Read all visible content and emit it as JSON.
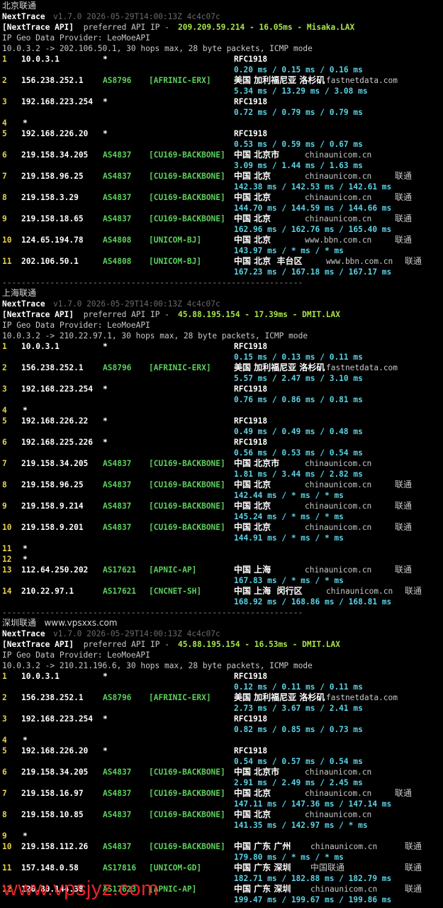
{
  "blocks": [
    {
      "title": "北京联通",
      "app": "NextTrace",
      "version": "v1.7.0 2026-05-29T14:00:13Z 4c4c07c",
      "api_prefix": "[NextTrace API]",
      "api_mid": " preferred API IP - ",
      "api_info": "209.209.59.214 - 16.05ms - Misaka.LAX",
      "geo_provider": "IP Geo Data Provider: LeoMoeAPI",
      "route": "10.0.3.2 -> 202.106.50.1, 30 hops max, 28 byte packets, ICMP mode",
      "hops": [
        {
          "n": "1",
          "ip": "10.0.3.1",
          "asn": "*",
          "tag": "",
          "geo": "RFC1918",
          "host": "",
          "isp": "",
          "lat": "0.20 ms / 0.15 ms / 0.16 ms"
        },
        {
          "n": "2",
          "ip": "156.238.252.1",
          "asn": "AS8796",
          "tag": "[AFRINIC-ERX]",
          "geo": "美国 加利福尼亚 洛杉矶",
          "host": "fastnetdata.com",
          "isp": "",
          "lat": "5.34 ms / 13.29 ms / 3.08 ms"
        },
        {
          "n": "3",
          "ip": "192.168.223.254",
          "asn": "*",
          "tag": "",
          "geo": "RFC1918",
          "host": "",
          "isp": "",
          "lat": "0.72 ms / 0.79 ms / 0.79 ms"
        },
        {
          "n": "4",
          "ip": "*",
          "asn": "",
          "tag": "",
          "geo": "",
          "host": "",
          "isp": "",
          "lat": ""
        },
        {
          "n": "5",
          "ip": "192.168.226.20",
          "asn": "*",
          "tag": "",
          "geo": "RFC1918",
          "host": "",
          "isp": "",
          "lat": "0.53 ms / 0.59 ms / 0.67 ms"
        },
        {
          "n": "6",
          "ip": "219.158.34.205",
          "asn": "AS4837",
          "tag": "[CU169-BACKBONE]",
          "geo": "中国 北京市",
          "host": "chinaunicom.cn",
          "isp": "",
          "lat": "3.09 ms / 1.44 ms / 1.63 ms"
        },
        {
          "n": "7",
          "ip": "219.158.96.25",
          "asn": "AS4837",
          "tag": "[CU169-BACKBONE]",
          "geo": "中国 北京",
          "host": "chinaunicom.cn",
          "isp": "联通",
          "lat": "142.38 ms / 142.53 ms / 142.61 ms"
        },
        {
          "n": "8",
          "ip": "219.158.3.29",
          "asn": "AS4837",
          "tag": "[CU169-BACKBONE]",
          "geo": "中国 北京",
          "host": "chinaunicom.cn",
          "isp": "联通",
          "lat": "144.70 ms / 144.59 ms / 144.66 ms"
        },
        {
          "n": "9",
          "ip": "219.158.18.65",
          "asn": "AS4837",
          "tag": "[CU169-BACKBONE]",
          "geo": "中国 北京",
          "host": "chinaunicom.cn",
          "isp": "联通",
          "lat": "162.96 ms / 162.76 ms / 165.40 ms"
        },
        {
          "n": "10",
          "ip": "124.65.194.78",
          "asn": "AS4808",
          "tag": "[UNICOM-BJ]",
          "geo": "中国 北京",
          "host": "www.bbn.com.cn",
          "isp": "联通",
          "lat": "143.97 ms / * ms / * ms"
        },
        {
          "n": "11",
          "ip": "202.106.50.1",
          "asn": "AS4808",
          "tag": "[UNICOM-BJ]",
          "geo": "中国 北京  丰台区",
          "host": "www.bbn.com.cn",
          "isp": "联通",
          "lat": "167.23 ms / 167.18 ms / 167.17 ms"
        }
      ],
      "separator": "---------------------------------------------------------------"
    },
    {
      "title": "上海联通",
      "app": "NextTrace",
      "version": "v1.7.0 2026-05-29T14:00:13Z 4c4c07c",
      "api_prefix": "[NextTrace API]",
      "api_mid": " preferred API IP - ",
      "api_info": "45.88.195.154 - 17.39ms - DMIT.LAX",
      "geo_provider": "IP Geo Data Provider: LeoMoeAPI",
      "route": "10.0.3.2 -> 210.22.97.1, 30 hops max, 28 byte packets, ICMP mode",
      "hops": [
        {
          "n": "1",
          "ip": "10.0.3.1",
          "asn": "*",
          "tag": "",
          "geo": "RFC1918",
          "host": "",
          "isp": "",
          "lat": "0.15 ms / 0.13 ms / 0.11 ms"
        },
        {
          "n": "2",
          "ip": "156.238.252.1",
          "asn": "AS8796",
          "tag": "[AFRINIC-ERX]",
          "geo": "美国 加利福尼亚 洛杉矶",
          "host": "fastnetdata.com",
          "isp": "",
          "lat": "5.57 ms / 2.47 ms / 3.10 ms"
        },
        {
          "n": "3",
          "ip": "192.168.223.254",
          "asn": "*",
          "tag": "",
          "geo": "RFC1918",
          "host": "",
          "isp": "",
          "lat": "0.76 ms / 0.86 ms / 0.81 ms"
        },
        {
          "n": "4",
          "ip": "*",
          "asn": "",
          "tag": "",
          "geo": "",
          "host": "",
          "isp": "",
          "lat": ""
        },
        {
          "n": "5",
          "ip": "192.168.226.22",
          "asn": "*",
          "tag": "",
          "geo": "RFC1918",
          "host": "",
          "isp": "",
          "lat": "0.49 ms / 0.49 ms / 0.48 ms"
        },
        {
          "n": "6",
          "ip": "192.168.225.226",
          "asn": "*",
          "tag": "",
          "geo": "RFC1918",
          "host": "",
          "isp": "",
          "lat": "0.56 ms / 0.53 ms / 0.54 ms"
        },
        {
          "n": "7",
          "ip": "219.158.34.205",
          "asn": "AS4837",
          "tag": "[CU169-BACKBONE]",
          "geo": "中国 北京市",
          "host": "chinaunicom.cn",
          "isp": "",
          "lat": "1.81 ms / 3.44 ms / 2.82 ms"
        },
        {
          "n": "8",
          "ip": "219.158.96.25",
          "asn": "AS4837",
          "tag": "[CU169-BACKBONE]",
          "geo": "中国 北京",
          "host": "chinaunicom.cn",
          "isp": "联通",
          "lat": "142.44 ms / * ms / * ms"
        },
        {
          "n": "9",
          "ip": "219.158.9.214",
          "asn": "AS4837",
          "tag": "[CU169-BACKBONE]",
          "geo": "中国 北京",
          "host": "chinaunicom.cn",
          "isp": "联通",
          "lat": "145.24 ms / * ms / * ms"
        },
        {
          "n": "10",
          "ip": "219.158.9.201",
          "asn": "AS4837",
          "tag": "[CU169-BACKBONE]",
          "geo": "中国 北京",
          "host": "chinaunicom.cn",
          "isp": "联通",
          "lat": "144.91 ms / * ms / * ms"
        },
        {
          "n": "11",
          "ip": "*",
          "asn": "",
          "tag": "",
          "geo": "",
          "host": "",
          "isp": "",
          "lat": ""
        },
        {
          "n": "12",
          "ip": "*",
          "asn": "",
          "tag": "",
          "geo": "",
          "host": "",
          "isp": "",
          "lat": ""
        },
        {
          "n": "13",
          "ip": "112.64.250.202",
          "asn": "AS17621",
          "tag": "[APNIC-AP]",
          "geo": "中国 上海",
          "host": "chinaunicom.cn",
          "isp": "联通",
          "lat": "167.83 ms / * ms / * ms"
        },
        {
          "n": "14",
          "ip": "210.22.97.1",
          "asn": "AS17621",
          "tag": "[CNCNET-SH]",
          "geo": "中国 上海  闵行区",
          "host": "chinaunicom.cn",
          "isp": "联通",
          "lat": "168.92 ms / 168.86 ms / 168.81 ms"
        }
      ],
      "separator": "---------------------------------------------------------------"
    },
    {
      "title": "深圳联通   www.vpsxxs.com",
      "app": "NextTrace",
      "version": "v1.7.0 2026-05-29T14:00:13Z 4c4c07c",
      "api_prefix": "[NextTrace API]",
      "api_mid": " preferred API IP - ",
      "api_info": "45.88.195.154 - 16.53ms - DMIT.LAX",
      "geo_provider": "IP Geo Data Provider: LeoMoeAPI",
      "route": "10.0.3.2 -> 210.21.196.6, 30 hops max, 28 byte packets, ICMP mode",
      "hops": [
        {
          "n": "1",
          "ip": "10.0.3.1",
          "asn": "*",
          "tag": "",
          "geo": "RFC1918",
          "host": "",
          "isp": "",
          "lat": "0.12 ms / 0.11 ms / 0.11 ms"
        },
        {
          "n": "2",
          "ip": "156.238.252.1",
          "asn": "AS8796",
          "tag": "[AFRINIC-ERX]",
          "geo": "美国 加利福尼亚 洛杉矶",
          "host": "fastnetdata.com",
          "isp": "",
          "lat": "2.73 ms / 3.67 ms / 2.41 ms"
        },
        {
          "n": "3",
          "ip": "192.168.223.254",
          "asn": "*",
          "tag": "",
          "geo": "RFC1918",
          "host": "",
          "isp": "",
          "lat": "0.82 ms / 0.85 ms / 0.73 ms"
        },
        {
          "n": "4",
          "ip": "*",
          "asn": "",
          "tag": "",
          "geo": "",
          "host": "",
          "isp": "",
          "lat": ""
        },
        {
          "n": "5",
          "ip": "192.168.226.20",
          "asn": "*",
          "tag": "",
          "geo": "RFC1918",
          "host": "",
          "isp": "",
          "lat": "0.54 ms / 0.57 ms / 0.54 ms"
        },
        {
          "n": "6",
          "ip": "219.158.34.205",
          "asn": "AS4837",
          "tag": "[CU169-BACKBONE]",
          "geo": "中国 北京市",
          "host": "chinaunicom.cn",
          "isp": "",
          "lat": "2.91 ms / 2.49 ms / 2.45 ms"
        },
        {
          "n": "7",
          "ip": "219.158.16.97",
          "asn": "AS4837",
          "tag": "[CU169-BACKBONE]",
          "geo": "中国 北京",
          "host": "chinaunicom.cn",
          "isp": "联通",
          "lat": "147.11 ms / 147.36 ms / 147.14 ms"
        },
        {
          "n": "8",
          "ip": "219.158.10.85",
          "asn": "AS4837",
          "tag": "[CU169-BACKBONE]",
          "geo": "中国 北京",
          "host": "chinaunicom.cn",
          "isp": "",
          "lat": "141.35 ms / 142.97 ms / * ms"
        },
        {
          "n": "9",
          "ip": "*",
          "asn": "",
          "tag": "",
          "geo": "",
          "host": "",
          "isp": "",
          "lat": ""
        },
        {
          "n": "10",
          "ip": "219.158.112.26",
          "asn": "AS4837",
          "tag": "[CU169-BACKBONE]",
          "geo": "中国 广东 广州",
          "host": "chinaunicom.cn",
          "isp": "联通",
          "lat": "179.80 ms / * ms / * ms"
        },
        {
          "n": "11",
          "ip": "157.148.0.58",
          "asn": "AS17816",
          "tag": "[UNICOM-GD]",
          "geo": "中国 广东 深圳",
          "host": "中国联通",
          "isp": "联通",
          "lat": "182.71 ms / 182.88 ms / 182.79 ms"
        },
        {
          "n": "12",
          "ip": "120.80.144.38",
          "asn": "AS17623",
          "tag": "[APNIC-AP]",
          "geo": "中国 广东 深圳",
          "host": "chinaunicom.cn",
          "isp": "联通",
          "lat": "199.47 ms / 199.67 ms / 199.86 ms"
        }
      ],
      "separator": ""
    }
  ],
  "watermark": "www.vpsjyz.com",
  "colors": {
    "background": "#000000",
    "latency": "#5ad2e6",
    "asn": "#5bd15b",
    "api_ip": "#a8e44a",
    "hop_number": "#e8d24a",
    "watermark": "#e8232a"
  }
}
